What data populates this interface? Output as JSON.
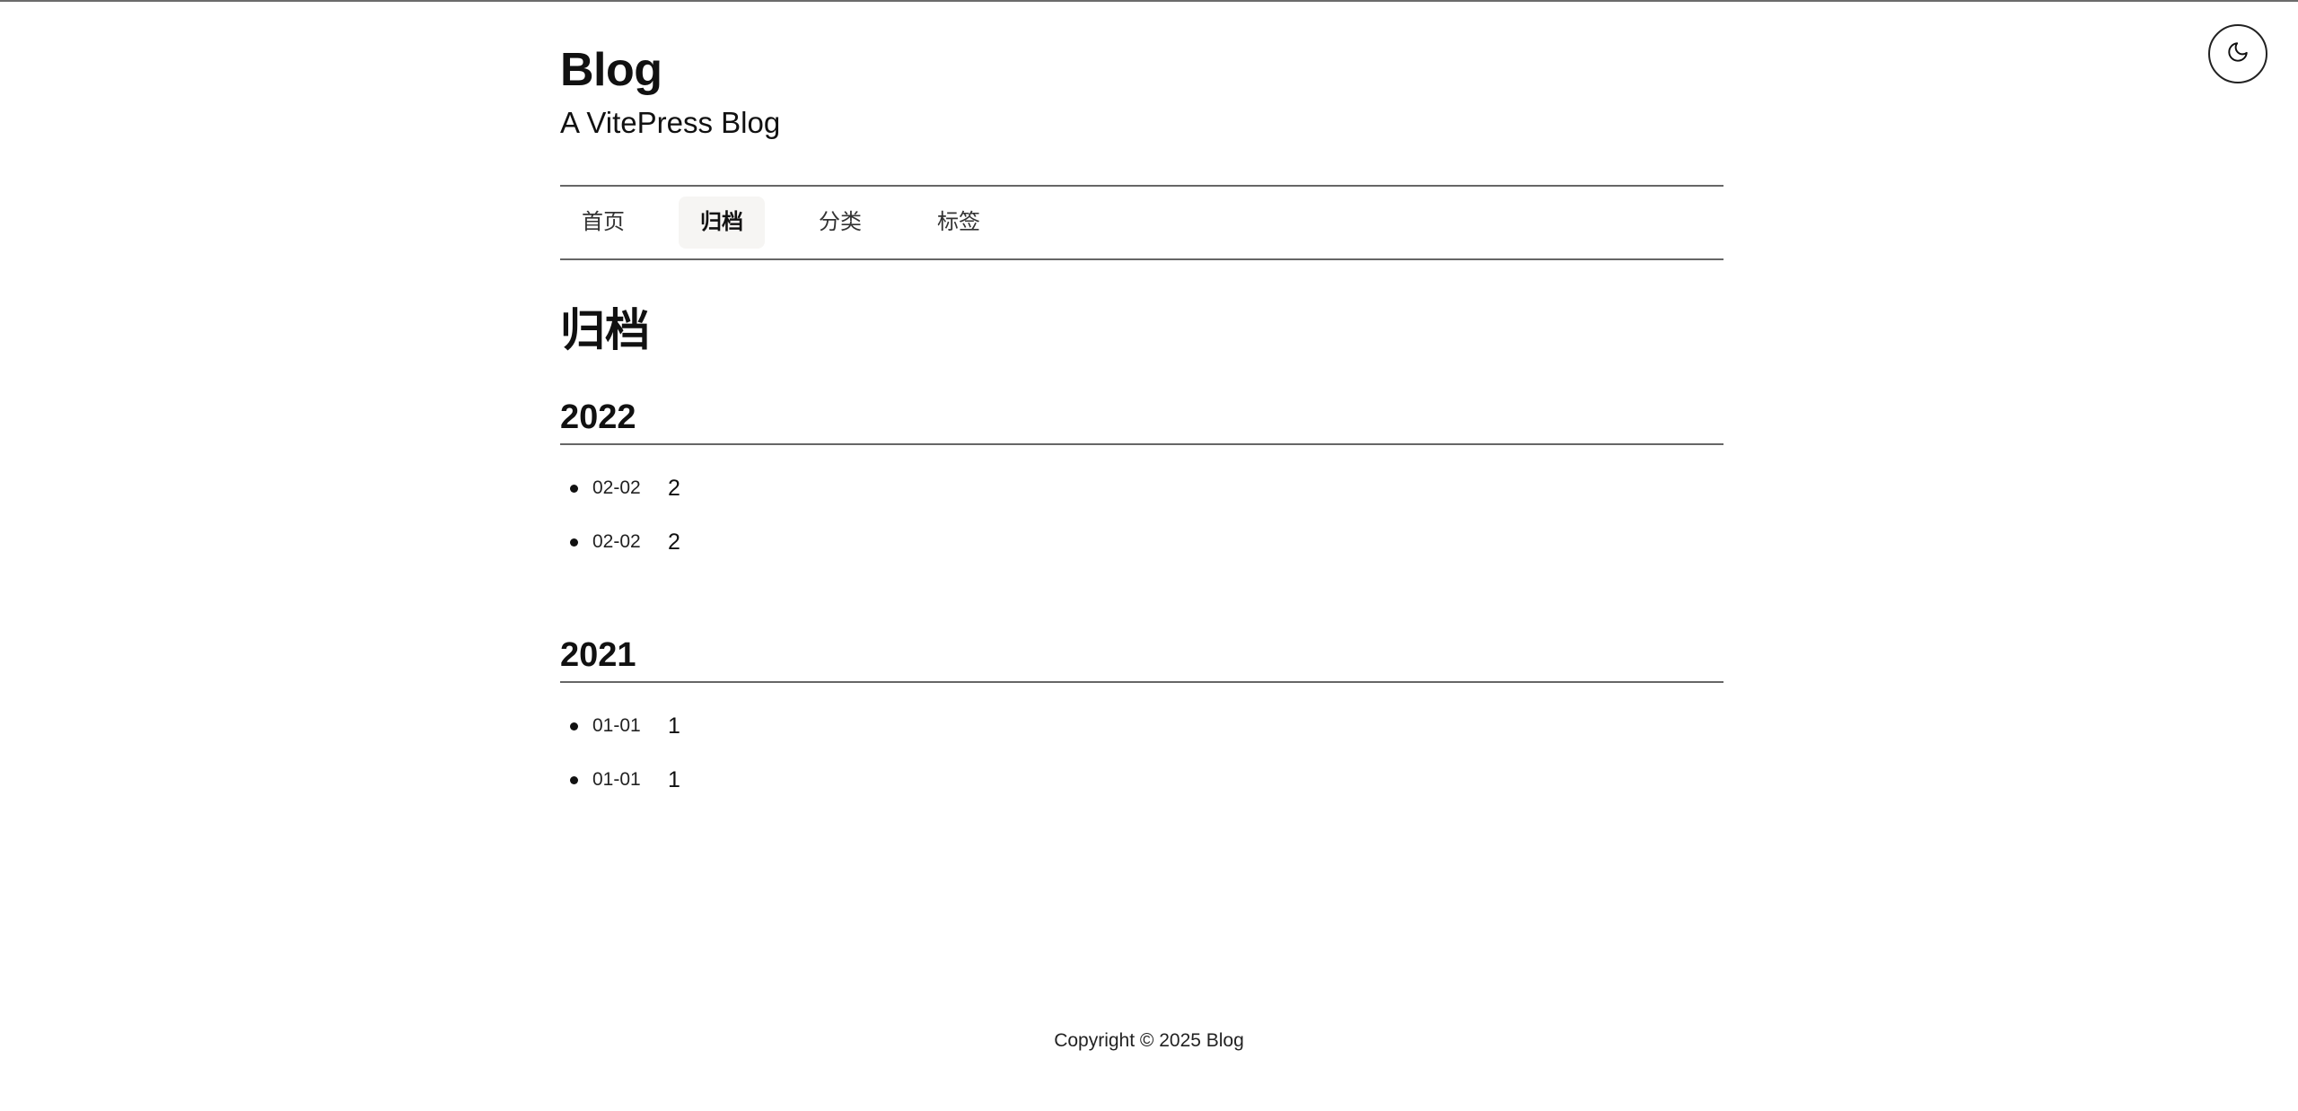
{
  "header": {
    "title": "Blog",
    "subtitle": "A VitePress Blog"
  },
  "theme_toggle": {
    "icon": "moon-icon"
  },
  "nav": {
    "items": [
      {
        "label": "首页",
        "active": false
      },
      {
        "label": "归档",
        "active": true
      },
      {
        "label": "分类",
        "active": false
      },
      {
        "label": "标签",
        "active": false
      }
    ]
  },
  "page": {
    "title": "归档"
  },
  "archive": [
    {
      "year": "2022",
      "posts": [
        {
          "date": "02-02",
          "title": "2"
        },
        {
          "date": "02-02",
          "title": "2"
        }
      ]
    },
    {
      "year": "2021",
      "posts": [
        {
          "date": "01-01",
          "title": "1"
        },
        {
          "date": "01-01",
          "title": "1"
        }
      ]
    }
  ],
  "footer": {
    "copyright": "Copyright © 2025 Blog"
  }
}
